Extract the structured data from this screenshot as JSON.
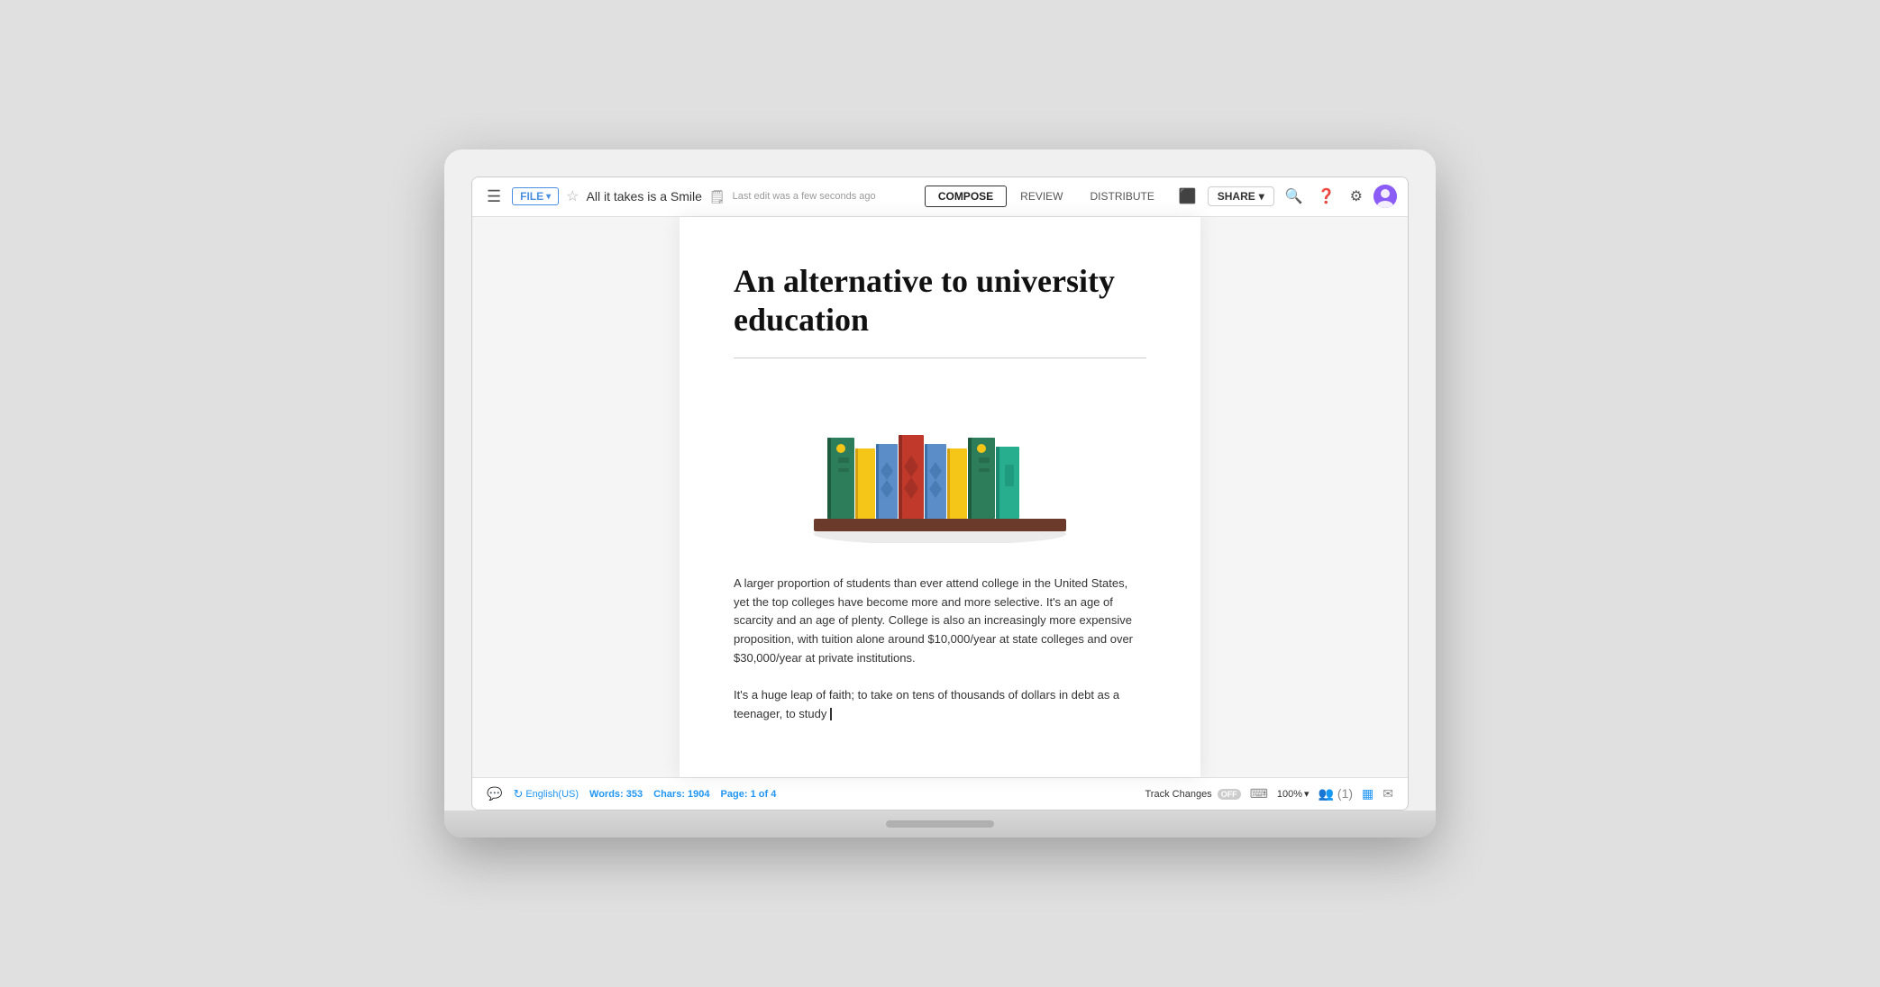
{
  "header": {
    "hamburger": "≡",
    "file_btn": "FILE",
    "file_chevron": "▾",
    "star": "☆",
    "doc_icon": "📄",
    "doc_title": "All it takes is a Smile",
    "last_edit": "Last edit was a few seconds ago",
    "tabs": [
      {
        "id": "compose",
        "label": "COMPOSE",
        "active": true
      },
      {
        "id": "review",
        "label": "REVIEW",
        "active": false
      },
      {
        "id": "distribute",
        "label": "DISTRIBUTE",
        "active": false
      }
    ],
    "toolbar_icons": [
      "📊",
      "?",
      "⚙"
    ],
    "share_label": "SHARE",
    "share_chevron": "▾"
  },
  "document": {
    "title": "An alternative to university education",
    "paragraph1": "A larger proportion of students than ever attend college in the United States, yet the top colleges have become more and more selective. It's an age of scarcity and an age of plenty. College is also an increasingly more expensive proposition, with tuition alone around $10,000/year at state colleges and over $30,000/year at private institutions.",
    "paragraph2": "It's a huge leap of faith; to take on tens of thousands of dollars in debt as a teenager, to study"
  },
  "statusbar": {
    "comment_icon": "💬",
    "lang_icon": "↺",
    "language": "English(US)",
    "words_label": "Words:",
    "words_count": "353",
    "chars_label": "Chars:",
    "chars_count": "1904",
    "page_label": "Page:",
    "page_current": "1",
    "page_separator": "of",
    "page_total": "4",
    "track_changes_label": "Track Changes",
    "track_changes_state": "OFF",
    "zoom": "100%",
    "collab_label": "(1)"
  }
}
